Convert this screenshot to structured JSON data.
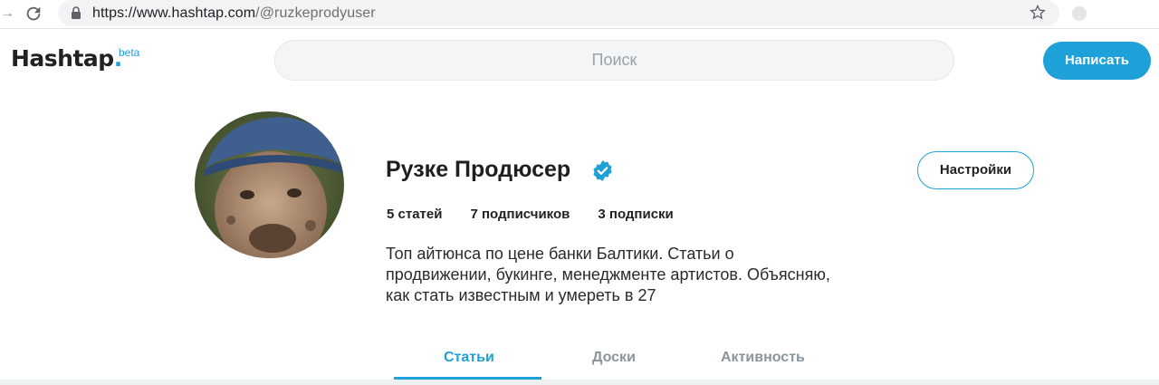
{
  "browser": {
    "url_host": "https://www.hashtap.com",
    "url_path": "/@ruzkeprodyuser"
  },
  "header": {
    "logo_text": "Hashtap",
    "logo_dot": ".",
    "logo_beta": "beta",
    "search_placeholder": "Поиск",
    "write_label": "Написать"
  },
  "profile": {
    "name": "Рузке Продюсер",
    "settings_label": "Настройки",
    "stats": {
      "articles": "5 статей",
      "followers": "7 подписчиков",
      "following": "3 подписки"
    },
    "bio_lines": [
      "Топ айтюнса по цене банки Балтики. Статьи о",
      "продвижении, букинге, менеджменте артистов. Объясняю,",
      "как стать известным и умереть в 27"
    ]
  },
  "tabs": {
    "articles": "Статьи",
    "boards": "Доски",
    "activity": "Активность"
  },
  "colors": {
    "accent": "#1ea1d8"
  }
}
